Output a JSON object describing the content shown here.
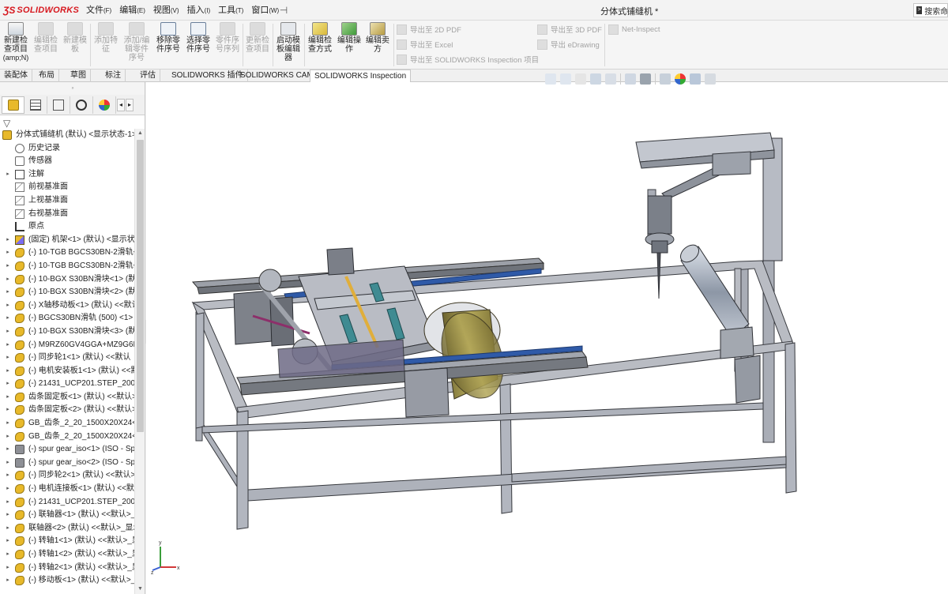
{
  "app": {
    "brand": "SOLIDWORKS",
    "document_title": "分体式铺缝机 *",
    "menus": [
      {
        "label": "文件",
        "key": "(F)"
      },
      {
        "label": "编辑",
        "key": "(E)"
      },
      {
        "label": "视图",
        "key": "(V)"
      },
      {
        "label": "插入",
        "key": "(I)"
      },
      {
        "label": "工具",
        "key": "(T)"
      },
      {
        "label": "窗口",
        "key": "(W)"
      }
    ],
    "search_text": "搜索命令"
  },
  "ribbon": {
    "buttons": [
      {
        "label": "新建检查项目",
        "sub": "(amp;N)",
        "icon": "new-inspection-project-icon",
        "enabled": true
      },
      {
        "label": "编辑检查项目",
        "icon": "edit-inspection-project-icon",
        "enabled": false
      },
      {
        "label": "新建模板",
        "icon": "new-template-icon",
        "enabled": false
      },
      {
        "label": "添加特征",
        "icon": "add-feature-icon",
        "enabled": false
      },
      {
        "label": "添加/编辑零件序号",
        "icon": "add-edit-balloon-icon",
        "enabled": false
      },
      {
        "label": "移除零件序号",
        "icon": "remove-balloon-icon",
        "enabled": true
      },
      {
        "label": "选择零件序号",
        "icon": "select-balloon-icon",
        "enabled": true
      },
      {
        "label": "零件序号序列",
        "icon": "balloon-sequence-icon",
        "enabled": false
      },
      {
        "label": "更新检查项目",
        "icon": "update-inspection-icon",
        "enabled": false
      },
      {
        "label": "启动模板编辑器",
        "icon": "template-editor-icon",
        "enabled": true
      },
      {
        "label": "编辑检查方式",
        "icon": "edit-inspection-method-icon",
        "enabled": true
      },
      {
        "label": "编辑操作",
        "icon": "edit-operation-icon",
        "enabled": true
      },
      {
        "label": "编辑卖方",
        "icon": "edit-vendor-icon",
        "enabled": true
      }
    ],
    "exports": [
      "导出至 2D PDF",
      "导出至 Excel",
      "导出至 SOLIDWORKS Inspection 项目",
      "导出至 3D PDF",
      "导出 eDrawing"
    ],
    "net_inspect": "Net-Inspect"
  },
  "command_tabs": [
    "装配体",
    "布局",
    "草图",
    "标注",
    "评估",
    "SOLIDWORKS 插件",
    "SOLIDWORKS CAM",
    "SOLIDWORKS Inspection"
  ],
  "active_tab": "SOLIDWORKS Inspection",
  "tree": {
    "root": "分体式铺缝机 (默认) <显示状态-1>",
    "items": [
      {
        "label": "历史记录",
        "icon": "history-folder-icon",
        "expand": false,
        "indent": 1
      },
      {
        "label": "传感器",
        "icon": "sensor-icon",
        "expand": false,
        "indent": 1
      },
      {
        "label": "注解",
        "icon": "annotation-icon",
        "expand": true,
        "indent": 1
      },
      {
        "label": "前视基准面",
        "icon": "plane-icon",
        "expand": false,
        "indent": 1
      },
      {
        "label": "上视基准面",
        "icon": "plane-icon",
        "expand": false,
        "indent": 1
      },
      {
        "label": "右视基准面",
        "icon": "plane-icon",
        "expand": false,
        "indent": 1
      },
      {
        "label": "原点",
        "icon": "origin-icon",
        "expand": false,
        "indent": 1
      },
      {
        "label": "(固定) 机架<1> (默认) <显示状态",
        "icon": "subassembly-icon",
        "expand": true,
        "indent": 1
      },
      {
        "label": "(-) 10-TGB BGCS30BN-2滑轨<",
        "icon": "part-icon",
        "expand": true,
        "indent": 1
      },
      {
        "label": "(-) 10-TGB BGCS30BN-2滑轨<",
        "icon": "part-icon",
        "expand": true,
        "indent": 1
      },
      {
        "label": "(-) 10-BGX S30BN滑块<1> (默",
        "icon": "part-icon",
        "expand": true,
        "indent": 1
      },
      {
        "label": "(-) 10-BGX S30BN滑块<2> (默",
        "icon": "part-icon",
        "expand": true,
        "indent": 1
      },
      {
        "label": "(-) X轴移动板<1> (默认) <<默认",
        "icon": "part-icon",
        "expand": true,
        "indent": 1
      },
      {
        "label": "(-) BGCS30BN滑轨 (500) <1>",
        "icon": "part-icon",
        "expand": true,
        "indent": 1
      },
      {
        "label": "(-) 10-BGX S30BN滑块<3> (默",
        "icon": "part-icon",
        "expand": true,
        "indent": 1
      },
      {
        "label": "(-) M9RZ60GV4GGA+MZ9G6B",
        "icon": "part-icon",
        "expand": true,
        "indent": 1
      },
      {
        "label": "(-) 同步轮1<1> (默认) <<默认",
        "icon": "part-icon",
        "expand": true,
        "indent": 1
      },
      {
        "label": "(-) 电机安装板1<1> (默认) <<默",
        "icon": "part-icon",
        "expand": true,
        "indent": 1
      },
      {
        "label": "(-) 21431_UCP201.STEP_2006<",
        "icon": "part-icon",
        "expand": true,
        "indent": 1
      },
      {
        "label": "齿条固定板<1> (默认) <<默认>",
        "icon": "part-icon",
        "expand": true,
        "indent": 1
      },
      {
        "label": "齿条固定板<2> (默认) <<默认>",
        "icon": "part-icon",
        "expand": true,
        "indent": 1
      },
      {
        "label": "GB_齿条_2_20_1500X20X24<1>",
        "icon": "part-icon",
        "expand": true,
        "indent": 1
      },
      {
        "label": "GB_齿条_2_20_1500X20X24<2>",
        "icon": "part-icon",
        "expand": true,
        "indent": 1
      },
      {
        "label": "(-) spur gear_iso<1> (ISO - Sp",
        "icon": "toolbox-part-icon",
        "expand": true,
        "indent": 1
      },
      {
        "label": "(-) spur gear_iso<2> (ISO - Sp",
        "icon": "toolbox-part-icon",
        "expand": true,
        "indent": 1
      },
      {
        "label": "(-) 同步轮2<1> (默认) <<默认>",
        "icon": "part-icon",
        "expand": true,
        "indent": 1
      },
      {
        "label": "(-) 电机连接板<1> (默认) <<默认",
        "icon": "part-icon",
        "expand": true,
        "indent": 1
      },
      {
        "label": "(-) 21431_UCP201.STEP_2006<",
        "icon": "part-icon",
        "expand": true,
        "indent": 1
      },
      {
        "label": "(-) 联轴器<1> (默认) <<默认>_",
        "icon": "part-icon",
        "expand": true,
        "indent": 1
      },
      {
        "label": "联轴器<2> (默认) <<默认>_显示",
        "icon": "part-icon",
        "expand": true,
        "indent": 1
      },
      {
        "label": "(-) 转轴1<1> (默认) <<默认>_显",
        "icon": "part-icon",
        "expand": true,
        "indent": 1
      },
      {
        "label": "(-) 转轴1<2> (默认) <<默认>_显",
        "icon": "part-icon",
        "expand": true,
        "indent": 1
      },
      {
        "label": "(-) 转轴2<1> (默认) <<默认>_显",
        "icon": "part-icon",
        "expand": true,
        "indent": 1
      },
      {
        "label": "(-) 移动板<1> (默认) <<默认>_",
        "icon": "part-icon",
        "expand": true,
        "indent": 1
      }
    ]
  },
  "triad": {
    "x": "x",
    "y": "y",
    "z": "z"
  },
  "colors": {
    "brand_red": "#d71920",
    "part_yellow": "#e8b92a",
    "frame_gray": "#b9bcc3",
    "rail_blue": "#2f5aa8",
    "drum_olive": "#a79a4e"
  }
}
